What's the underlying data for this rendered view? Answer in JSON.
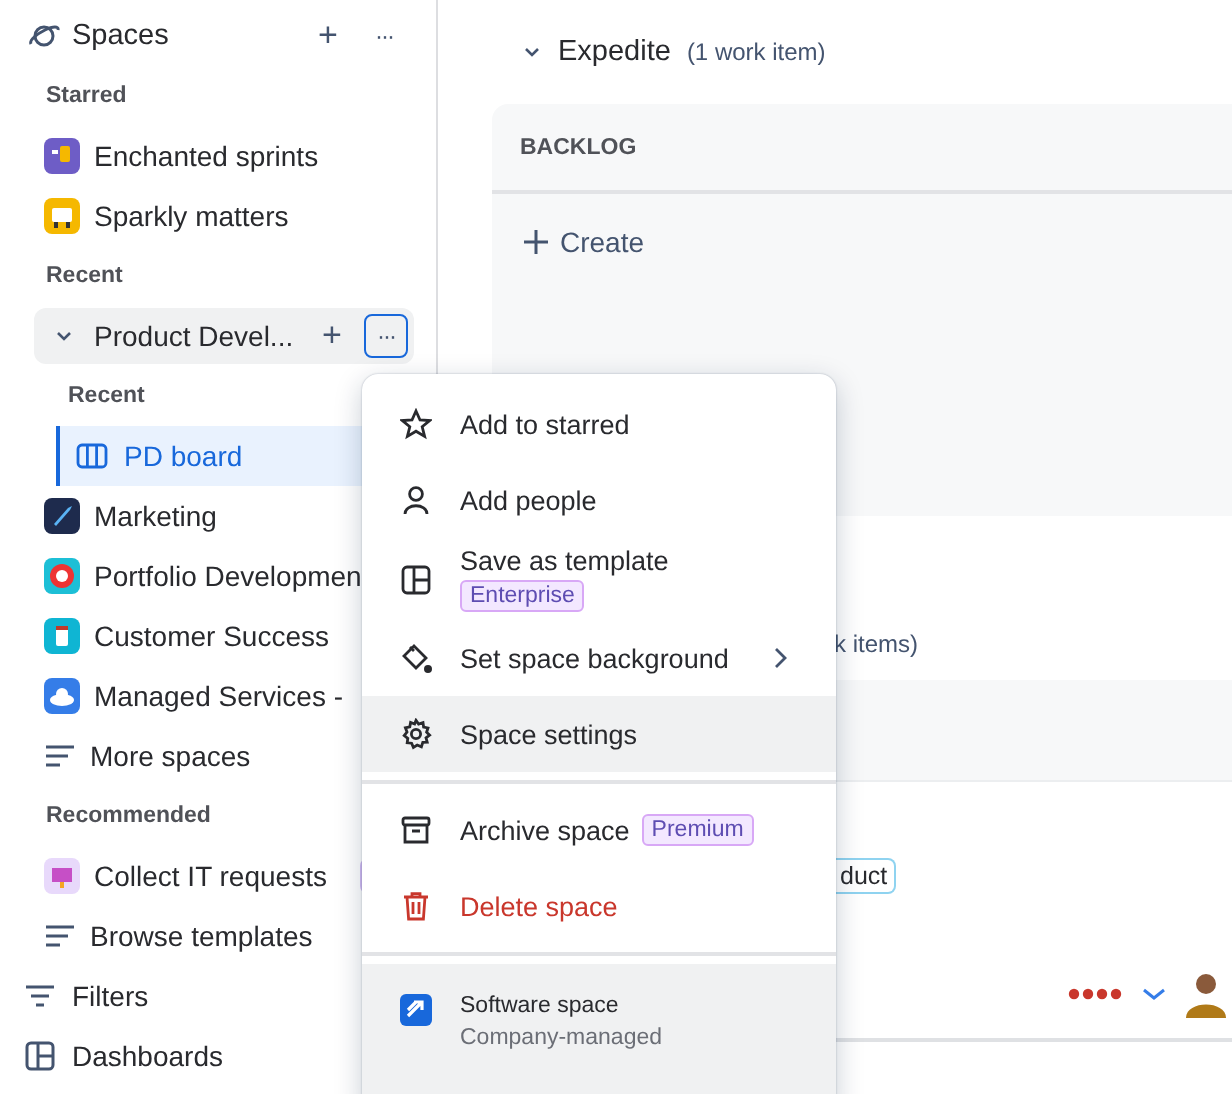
{
  "sidebar": {
    "title": "Spaces",
    "add": "+",
    "more": "···",
    "items": [
      {
        "kind": "section",
        "label": "Starred"
      },
      {
        "kind": "space",
        "label": "Enchanted sprints",
        "color": "#6e5dc6",
        "selected": false
      },
      {
        "kind": "space",
        "label": "Sparkly matters",
        "color": "#f5b800",
        "selected": false
      },
      {
        "kind": "section",
        "label": "Recent"
      },
      {
        "kind": "expander",
        "label": "Product Devel...",
        "expanded": true,
        "menu_open": true,
        "add": "+",
        "more": "···",
        "children": [
          {
            "kind": "subsection",
            "label": "Recent"
          },
          {
            "kind": "board",
            "label": "PD board",
            "selected": true
          }
        ]
      },
      {
        "kind": "space",
        "label": "Marketing",
        "color": "#1e2b4d",
        "selected": false
      },
      {
        "kind": "space",
        "label": "Portfolio Developmen",
        "color": "#1dbfd6",
        "selected": false
      },
      {
        "kind": "space",
        "label": "Customer Success",
        "color": "#0fb5d3",
        "selected": false
      },
      {
        "kind": "space",
        "label": "Managed Services -",
        "color": "#357de8",
        "selected": false
      },
      {
        "kind": "more",
        "label": "More spaces",
        "selected": false
      },
      {
        "kind": "section",
        "label": "Recommended"
      },
      {
        "kind": "space",
        "label": "Collect IT requests",
        "color": "#e8d9fb",
        "badge": true,
        "selected": false
      },
      {
        "kind": "more",
        "label": "Browse templates",
        "selected": false
      },
      {
        "kind": "filters",
        "label": "Filters",
        "selected": false
      },
      {
        "kind": "dashboards",
        "label": "Dashboards",
        "selected": false
      }
    ]
  },
  "board": {
    "groups": [
      {
        "title": "Expedite",
        "count": "(1 work item)",
        "expanded": true,
        "column": "BACKLOG",
        "create": "Create"
      },
      {
        "count": "k items)",
        "card": {
          "tag": "duct"
        }
      }
    ]
  },
  "context_menu": {
    "items": [
      {
        "kind": "item",
        "label": "Add to starred",
        "selected": false
      },
      {
        "kind": "item",
        "label": "Add people",
        "selected": false
      },
      {
        "kind": "item",
        "label": "Save as template",
        "badge": "Enterprise",
        "selected": false
      },
      {
        "kind": "item",
        "label": "Set space background",
        "submenu": true,
        "selected": false
      },
      {
        "kind": "item",
        "label": "Space settings",
        "selected": true
      },
      {
        "kind": "divider"
      },
      {
        "kind": "item",
        "label": "Archive space",
        "badge": "Premium",
        "badge_inline": true,
        "selected": false
      },
      {
        "kind": "item",
        "label": "Delete space",
        "danger": true,
        "selected": false
      },
      {
        "kind": "divider"
      }
    ],
    "footer": {
      "title": "Software space",
      "subtitle": "Company-managed"
    }
  }
}
